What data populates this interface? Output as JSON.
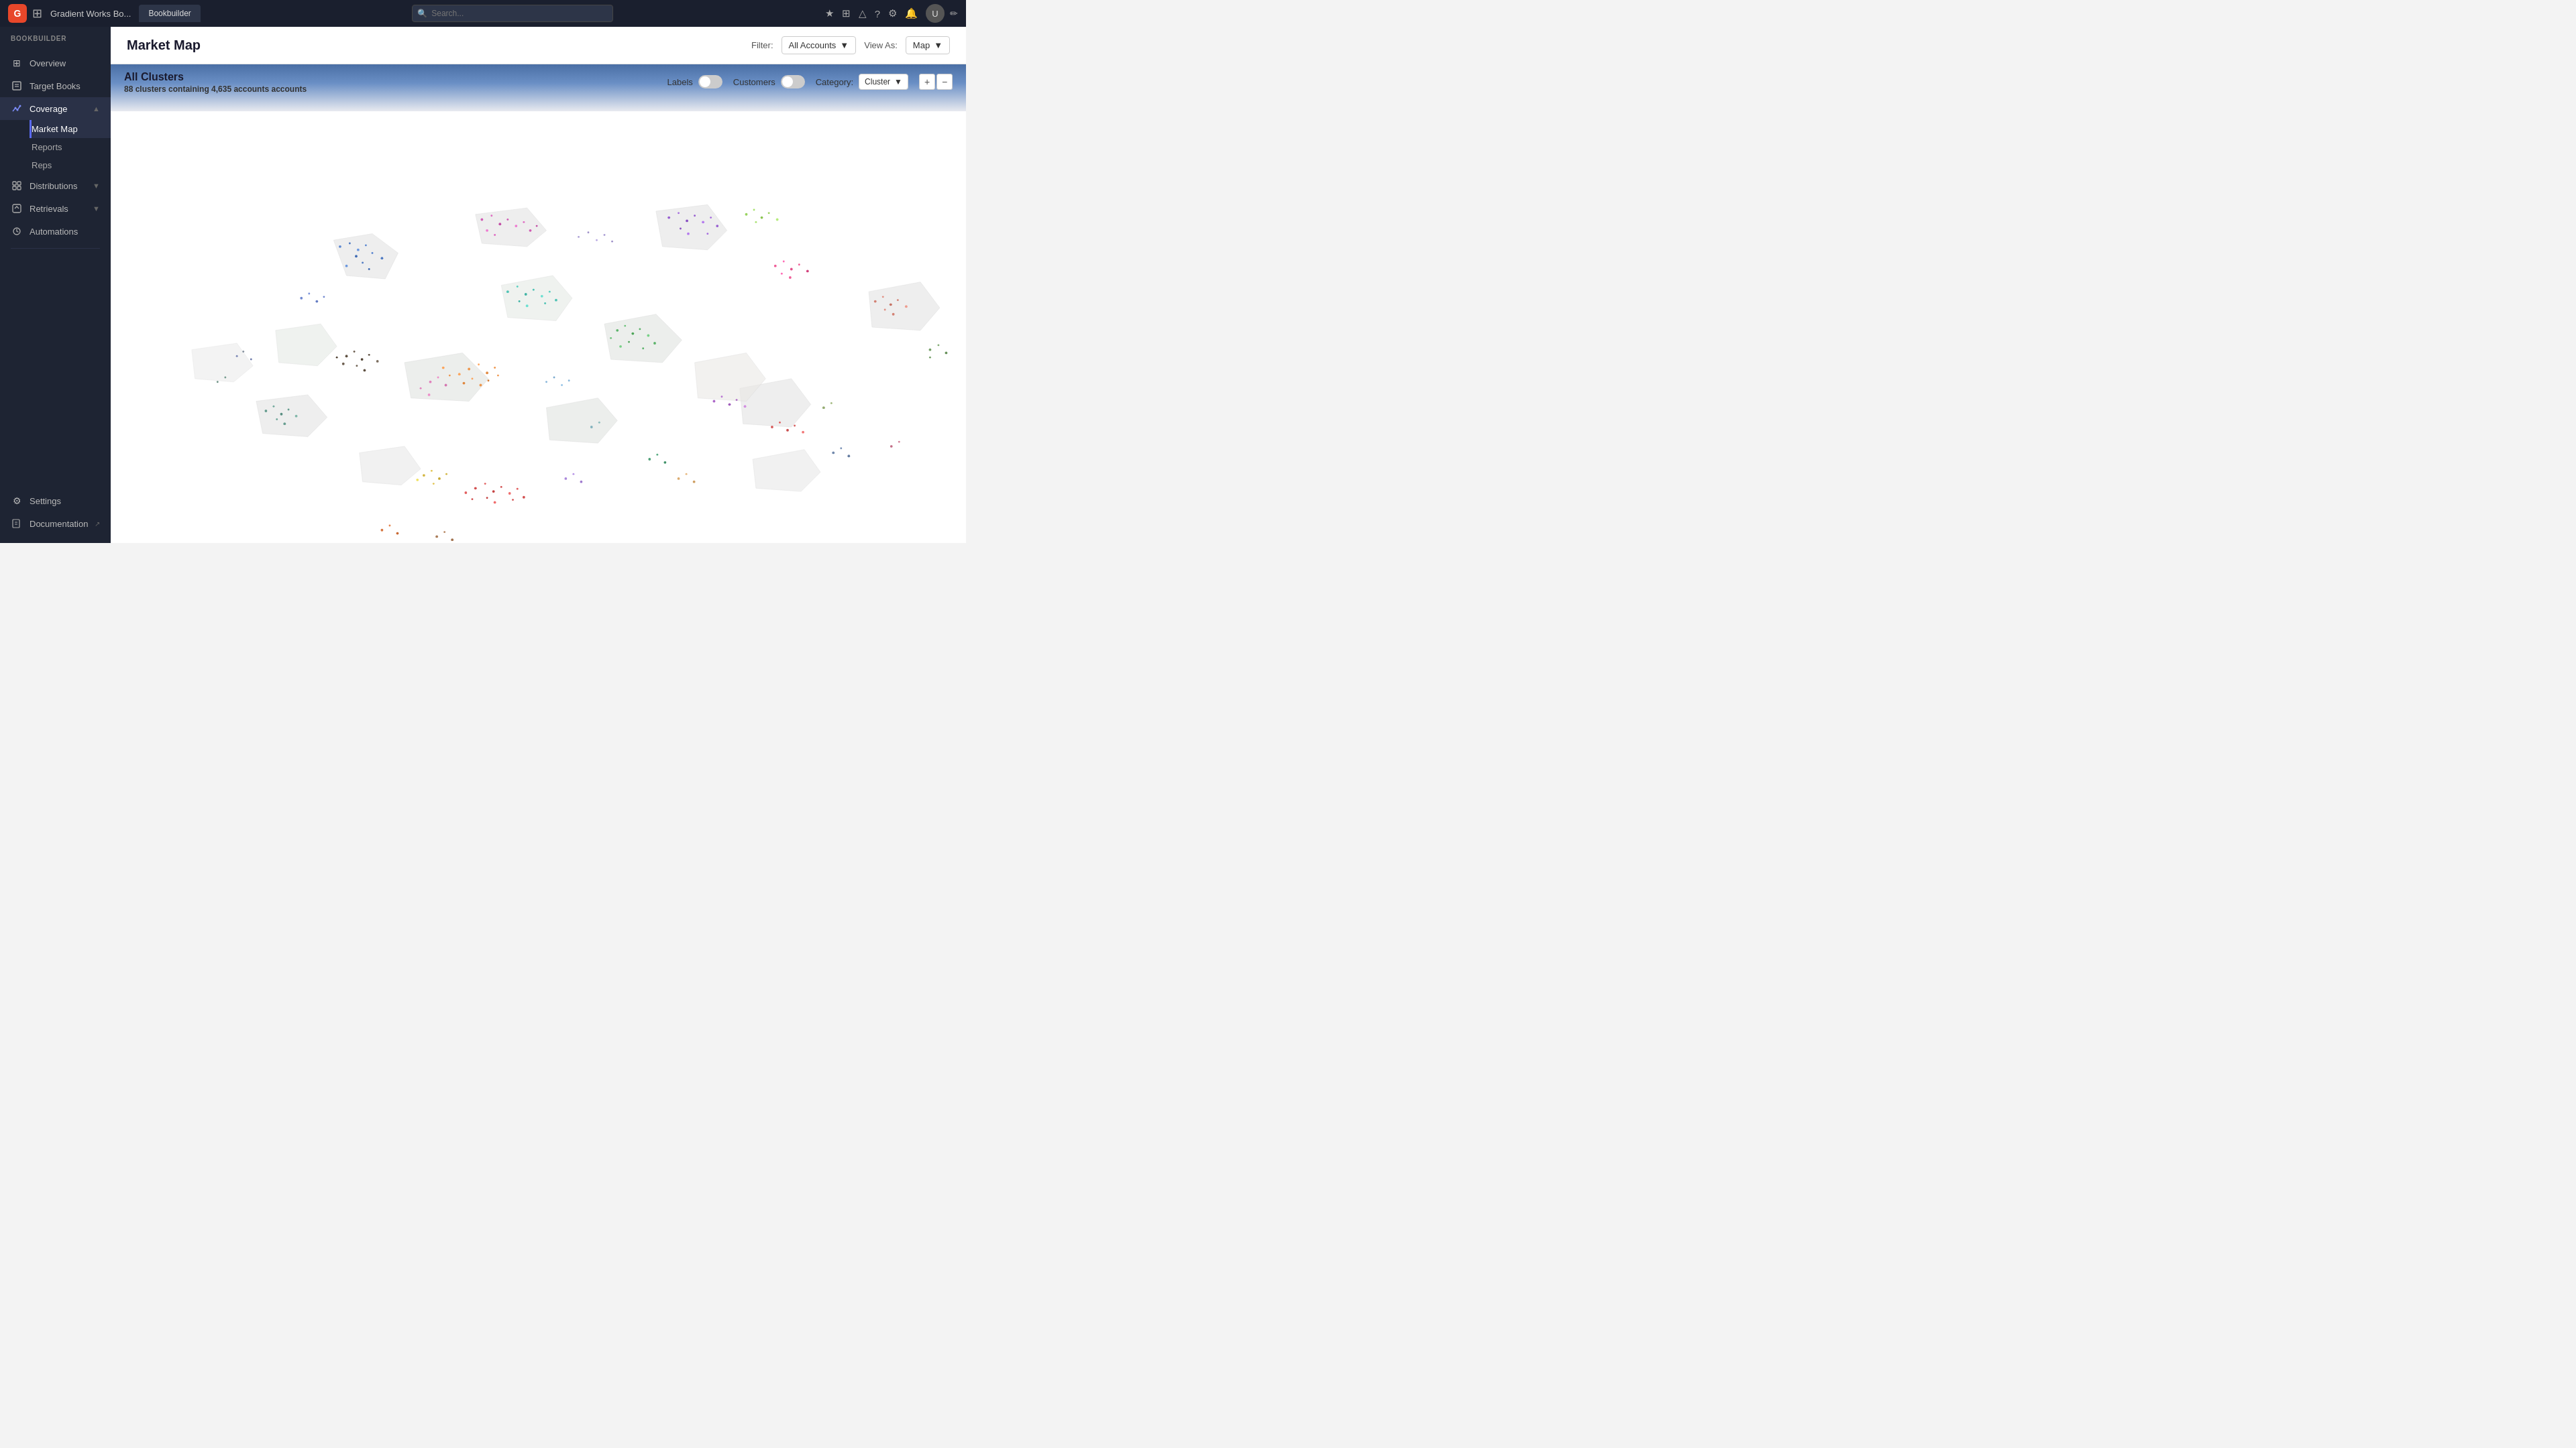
{
  "topnav": {
    "logo_text": "G",
    "app_title": "Gradient Works Bo...",
    "tab_label": "Bookbuilder",
    "search_placeholder": "Search...",
    "pencil_icon": "✏",
    "icons": [
      "★",
      "⊞",
      "△",
      "?",
      "⚙",
      "🔔"
    ]
  },
  "sidebar": {
    "header": "BOOKBUILDER",
    "items": [
      {
        "id": "overview",
        "label": "Overview",
        "icon": "⊞"
      },
      {
        "id": "target-books",
        "label": "Target Books",
        "icon": "📋"
      },
      {
        "id": "coverage",
        "label": "Coverage",
        "icon": "〰",
        "expanded": true,
        "active": true
      },
      {
        "id": "distributions",
        "label": "Distributions",
        "icon": "◫",
        "expandable": true
      },
      {
        "id": "retrievals",
        "label": "Retrievals",
        "icon": "↩",
        "expandable": true
      },
      {
        "id": "automations",
        "label": "Automations",
        "icon": "⚡"
      }
    ],
    "coverage_subitems": [
      {
        "id": "market-map",
        "label": "Market Map",
        "active": true
      },
      {
        "id": "reports",
        "label": "Reports"
      },
      {
        "id": "reps",
        "label": "Reps"
      }
    ],
    "bottom_items": [
      {
        "id": "settings",
        "label": "Settings",
        "icon": "⚙"
      },
      {
        "id": "documentation",
        "label": "Documentation",
        "icon": "📄",
        "external": true
      }
    ]
  },
  "page": {
    "title": "Market Map",
    "filter_label": "Filter:",
    "filter_value": "All Accounts",
    "view_as_label": "View As:",
    "view_as_value": "Map"
  },
  "map": {
    "section_title": "All Clusters",
    "cluster_count": "88 clusters",
    "account_count": "4,635 accounts",
    "labels_toggle": false,
    "customers_toggle": false,
    "category_label": "Category:",
    "category_value": "Cluster",
    "zoom_in": "+",
    "zoom_out": "−"
  }
}
